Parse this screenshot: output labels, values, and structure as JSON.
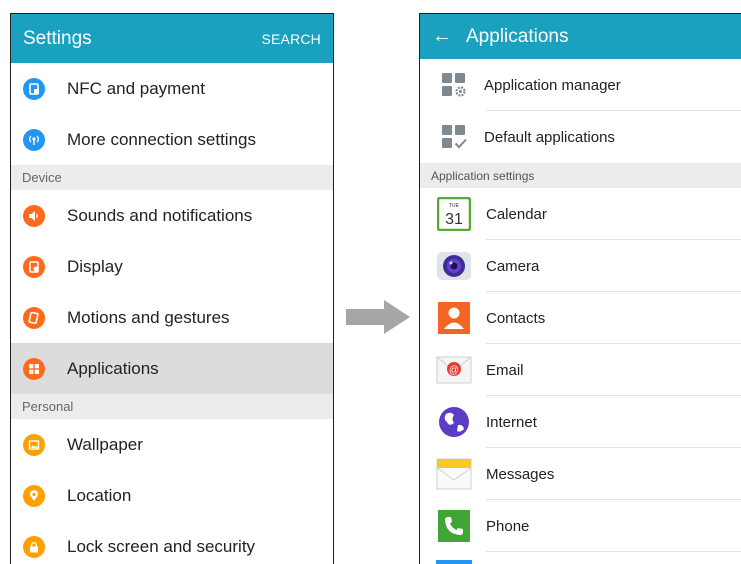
{
  "left": {
    "title": "Settings",
    "search_label": "SEARCH",
    "items_top": [
      {
        "label": "NFC and payment",
        "icon": "nfc-icon",
        "color": "#2196f3"
      },
      {
        "label": "More connection settings",
        "icon": "connection-icon",
        "color": "#2196f3"
      }
    ],
    "section_device": "Device",
    "items_device": [
      {
        "label": "Sounds and notifications",
        "icon": "sound-icon",
        "color": "#ff6a1a"
      },
      {
        "label": "Display",
        "icon": "display-icon",
        "color": "#ff6a1a"
      },
      {
        "label": "Motions and gestures",
        "icon": "motion-icon",
        "color": "#ff6a1a"
      },
      {
        "label": "Applications",
        "icon": "applications-icon",
        "color": "#ff6a1a"
      }
    ],
    "section_personal": "Personal",
    "items_personal": [
      {
        "label": "Wallpaper",
        "icon": "wallpaper-icon",
        "color": "#ffa000"
      },
      {
        "label": "Location",
        "icon": "location-icon",
        "color": "#ffa000"
      },
      {
        "label": "Lock screen and security",
        "icon": "lock-icon",
        "color": "#ffa000"
      }
    ]
  },
  "right": {
    "title": "Applications",
    "items_top": [
      {
        "label": "Application manager",
        "icon": "app-manager-icon"
      },
      {
        "label": "Default applications",
        "icon": "default-apps-icon"
      }
    ],
    "section_header": "Application settings",
    "apps": [
      {
        "label": "Calendar",
        "icon": "calendar-icon",
        "calendar_day": "31",
        "calendar_weekday": "TUE"
      },
      {
        "label": "Camera",
        "icon": "camera-icon"
      },
      {
        "label": "Contacts",
        "icon": "contacts-icon"
      },
      {
        "label": "Email",
        "icon": "email-icon"
      },
      {
        "label": "Internet",
        "icon": "internet-icon"
      },
      {
        "label": "Messages",
        "icon": "messages-icon"
      },
      {
        "label": "Phone",
        "icon": "phone-icon"
      }
    ]
  },
  "colors": {
    "appbar": "#1aa1c0",
    "selected_row": "#dcdcdc",
    "arrow": "#a6a6a6"
  }
}
